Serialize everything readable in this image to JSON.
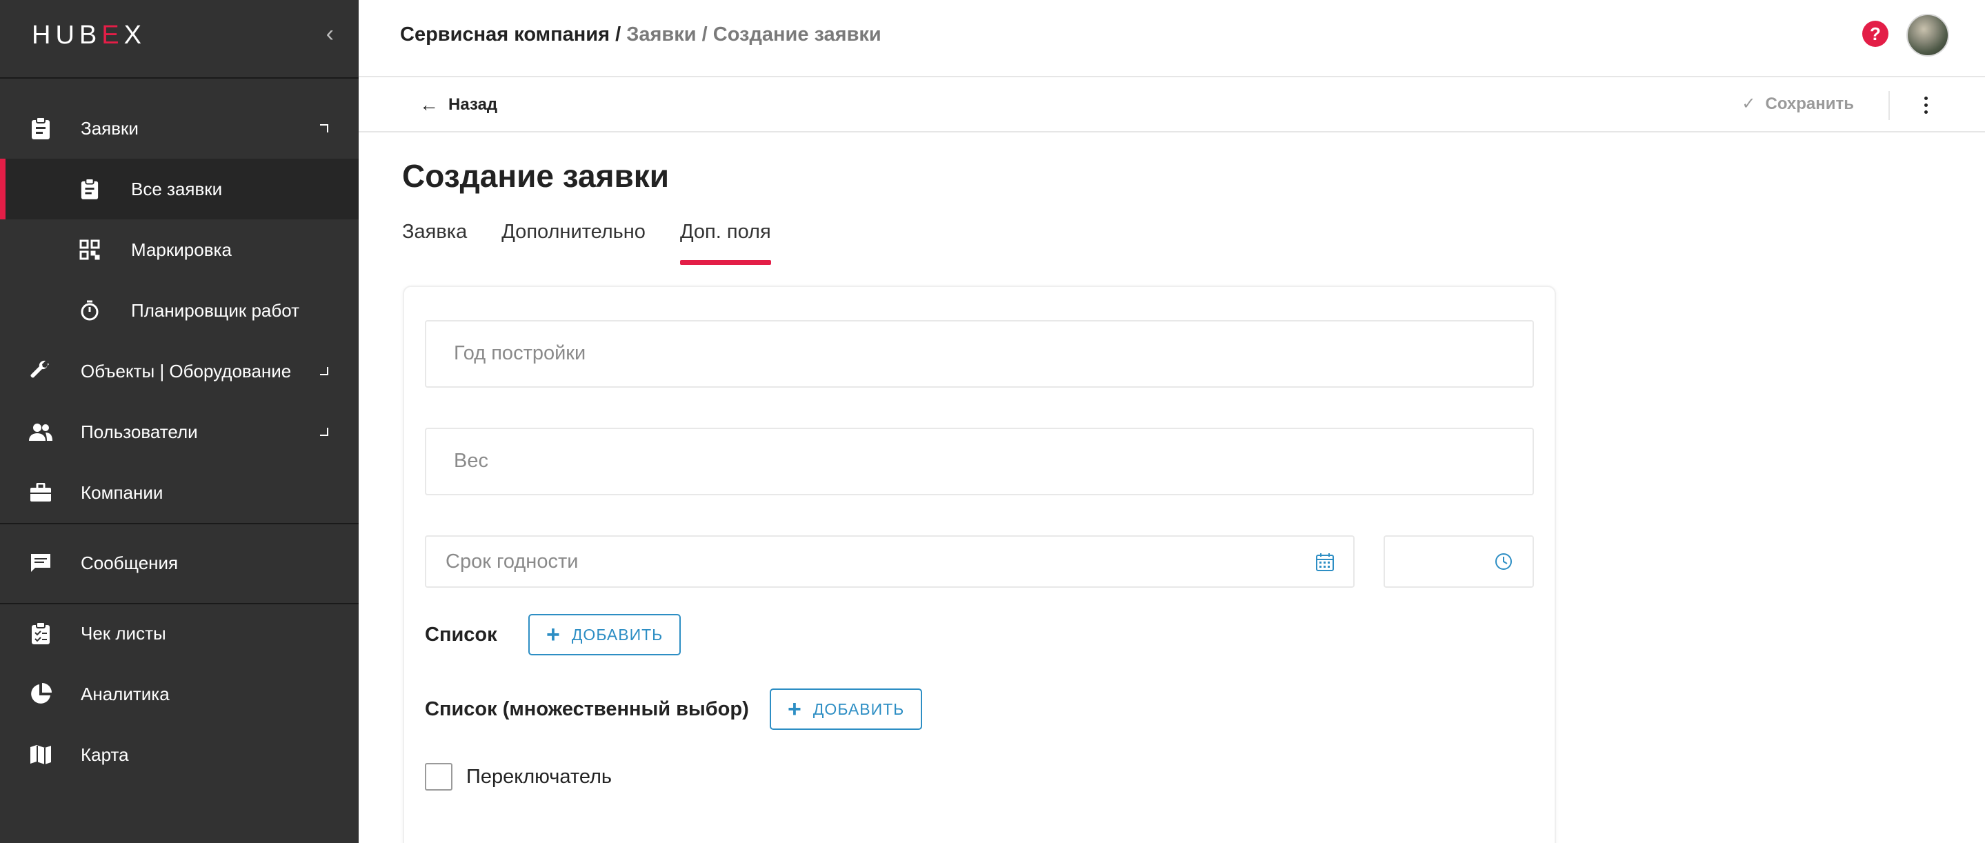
{
  "app": {
    "logo": "HUBEX",
    "collapse_icon": "chevron-left-icon"
  },
  "sidebar": {
    "items": [
      {
        "label": "Заявки",
        "icon": "clipboard-icon"
      },
      {
        "label": "Все заявки",
        "icon": "clipboard-icon"
      },
      {
        "label": "Маркировка",
        "icon": "qr-code-icon"
      },
      {
        "label": "Планировщик работ",
        "icon": "stopwatch-icon"
      },
      {
        "label": "Объекты | Оборудование",
        "icon": "wrench-icon"
      },
      {
        "label": "Пользователи",
        "icon": "users-icon"
      },
      {
        "label": "Компании",
        "icon": "briefcase-icon"
      },
      {
        "label": "Сообщения",
        "icon": "message-icon"
      },
      {
        "label": "Чек листы",
        "icon": "checklist-icon"
      },
      {
        "label": "Аналитика",
        "icon": "pie-chart-icon"
      },
      {
        "label": "Карта",
        "icon": "map-icon"
      }
    ]
  },
  "header": {
    "breadcrumb_first": "Сервисная компания /",
    "breadcrumb_rest": " Заявки / Создание заявки",
    "help_icon": "help-icon"
  },
  "toolbar": {
    "back_label": "Назад",
    "save_label": "Сохранить"
  },
  "page": {
    "title": "Создание заявки",
    "tabs": [
      {
        "label": "Заявка",
        "active": false
      },
      {
        "label": "Дополнительно",
        "active": false
      },
      {
        "label": "Доп. поля",
        "active": true
      }
    ]
  },
  "form": {
    "year_placeholder": "Год постройки",
    "weight_placeholder": "Вес",
    "expiry_placeholder": "Срок годности",
    "time_placeholder": "",
    "list_label": "Список",
    "list_multi_label": "Список (множественный выбор)",
    "add_label": "ДОБАВИТЬ",
    "switch_label": "Переключатель",
    "switch_checked": false
  },
  "colors": {
    "accent": "#e31e47",
    "link": "#2d8ec4",
    "sidebar_bg": "#323232"
  }
}
